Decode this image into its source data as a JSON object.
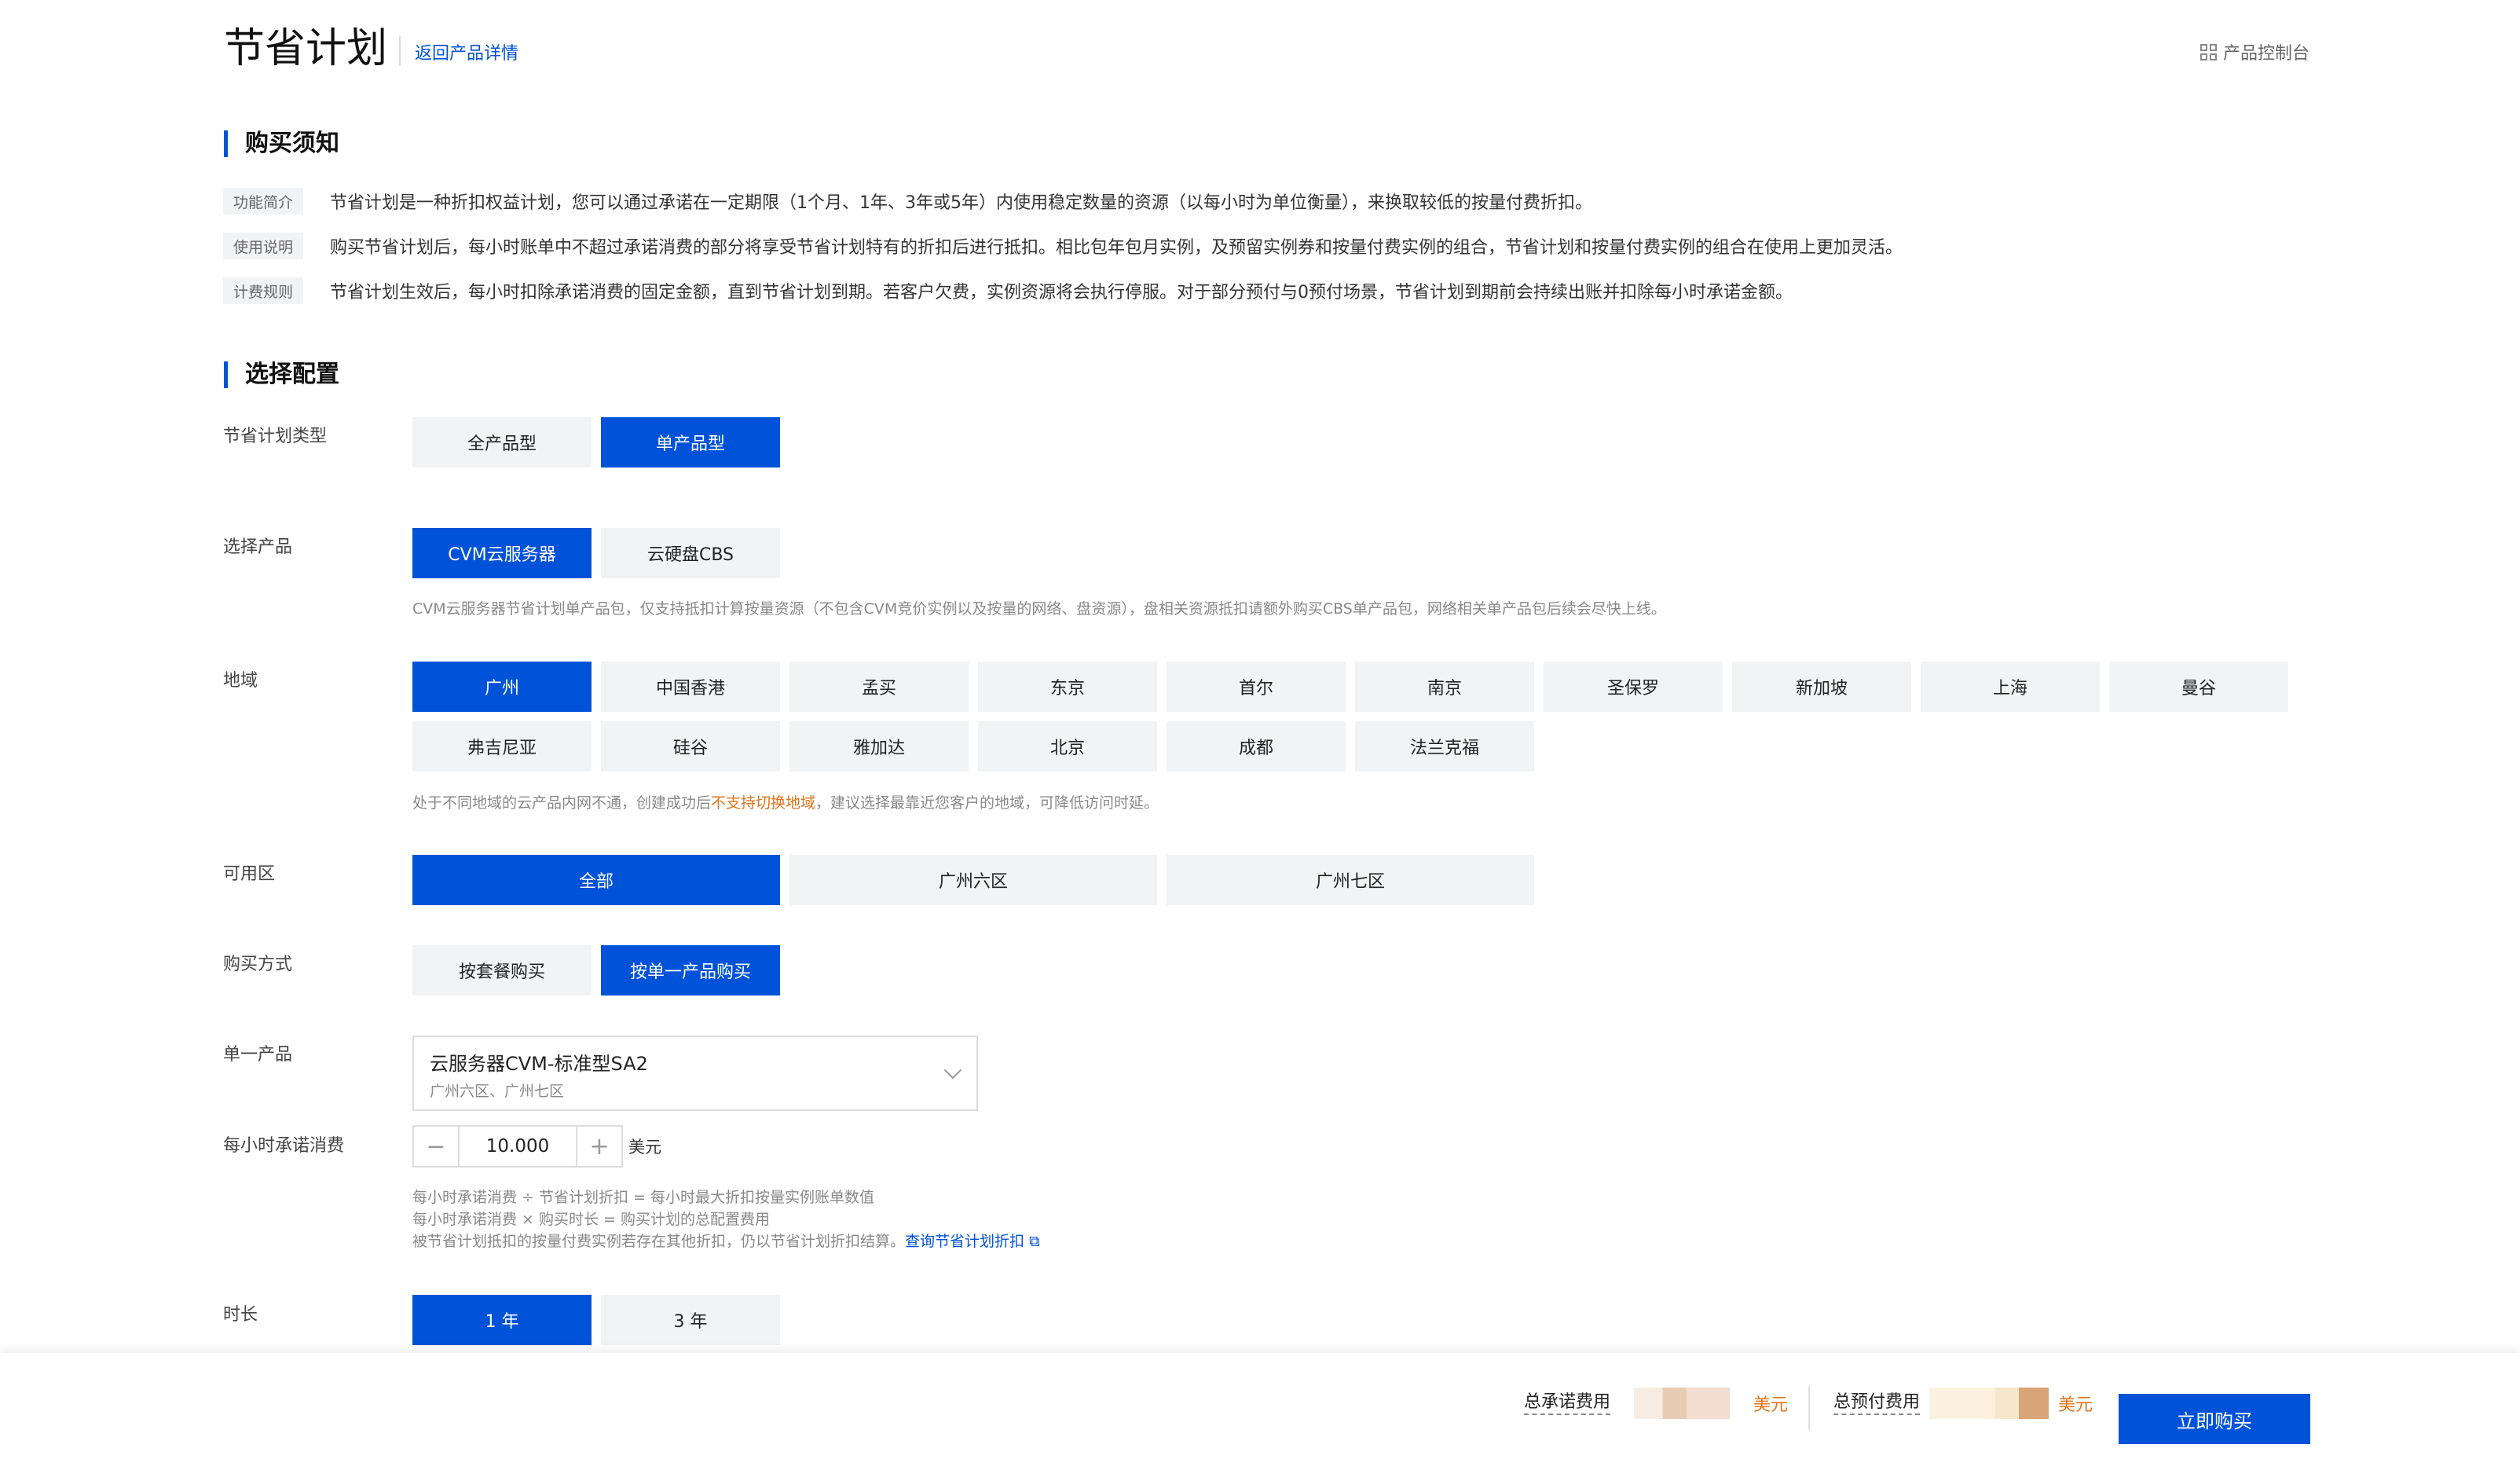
{
  "header": {
    "title": "节省计划",
    "back_link": "返回产品详情",
    "console_link": "产品控制台"
  },
  "notice": {
    "title": "购买须知",
    "rows": [
      {
        "tag": "功能简介",
        "text": "节省计划是一种折扣权益计划，您可以通过承诺在一定期限（1个月、1年、3年或5年）内使用稳定数量的资源（以每小时为单位衡量），来换取较低的按量付费折扣。"
      },
      {
        "tag": "使用说明",
        "text": "购买节省计划后，每小时账单中不超过承诺消费的部分将享受节省计划特有的折扣后进行抵扣。相比包年包月实例，及预留实例券和按量付费实例的组合，节省计划和按量付费实例的组合在使用上更加灵活。"
      },
      {
        "tag": "计费规则",
        "text": "节省计划生效后，每小时扣除承诺消费的固定金额，直到节省计划到期。若客户欠费，实例资源将会执行停服。对于部分预付与0预付场景，节省计划到期前会持续出账并扣除每小时承诺金额。"
      }
    ]
  },
  "config": {
    "title": "选择配置",
    "plan_type": {
      "label": "节省计划类型",
      "options": [
        "全产品型",
        "单产品型"
      ],
      "selected": 1
    },
    "product": {
      "label": "选择产品",
      "options": [
        "CVM云服务器",
        "云硬盘CBS"
      ],
      "selected": 0,
      "hint": "CVM云服务器节省计划单产品包，仅支持抵扣计算按量资源（不包含CVM竞价实例以及按量的网络、盘资源），盘相关资源抵扣请额外购买CBS单产品包，网络相关单产品包后续会尽快上线。"
    },
    "region": {
      "label": "地域",
      "row1": [
        "广州",
        "中国香港",
        "孟买",
        "东京",
        "首尔",
        "南京",
        "圣保罗",
        "新加坡",
        "上海",
        "曼谷"
      ],
      "row2": [
        "弗吉尼亚",
        "硅谷",
        "雅加达",
        "北京",
        "成都",
        "法兰克福"
      ],
      "selected": "广州",
      "hint_prefix": "处于不同地域的云产品内网不通，创建成功后",
      "hint_warn": "不支持切换地域",
      "hint_suffix": "，建议选择最靠近您客户的地域，可降低访问时延。"
    },
    "zone": {
      "label": "可用区",
      "options": [
        "全部",
        "广州六区",
        "广州七区"
      ],
      "selected": 0
    },
    "purchase_method": {
      "label": "购买方式",
      "options": [
        "按套餐购买",
        "按单一产品购买"
      ],
      "selected": 1
    },
    "single_product": {
      "label": "单一产品",
      "value": "云服务器CVM-标准型SA2",
      "sub": "广州六区、广州七区"
    },
    "hourly_commit": {
      "label": "每小时承诺消费",
      "minus": "−",
      "value": "10.000",
      "plus": "+",
      "unit": "美元",
      "hint1": "每小时承诺消费 ÷ 节省计划折扣 = 每小时最大折扣按量实例账单数值",
      "hint2": "每小时承诺消费 × 购买时长 = 购买计划的总配置费用",
      "hint3": "被节省计划抵扣的按量付费实例若存在其他折扣，仍以节省计划折扣结算。",
      "hint3_link": "查询节省计划折扣"
    },
    "duration": {
      "label": "时长",
      "options": [
        "1 年",
        "3 年"
      ],
      "selected": 0
    }
  },
  "footer": {
    "total_commit_label": "总承诺费用",
    "total_commit_unit": "美元",
    "total_prepay_label": "总预付费用",
    "total_prepay_unit": "美元",
    "buy_button": "立即购买"
  },
  "colors": {
    "accent": "#0052d9",
    "warn": "#e37318"
  }
}
